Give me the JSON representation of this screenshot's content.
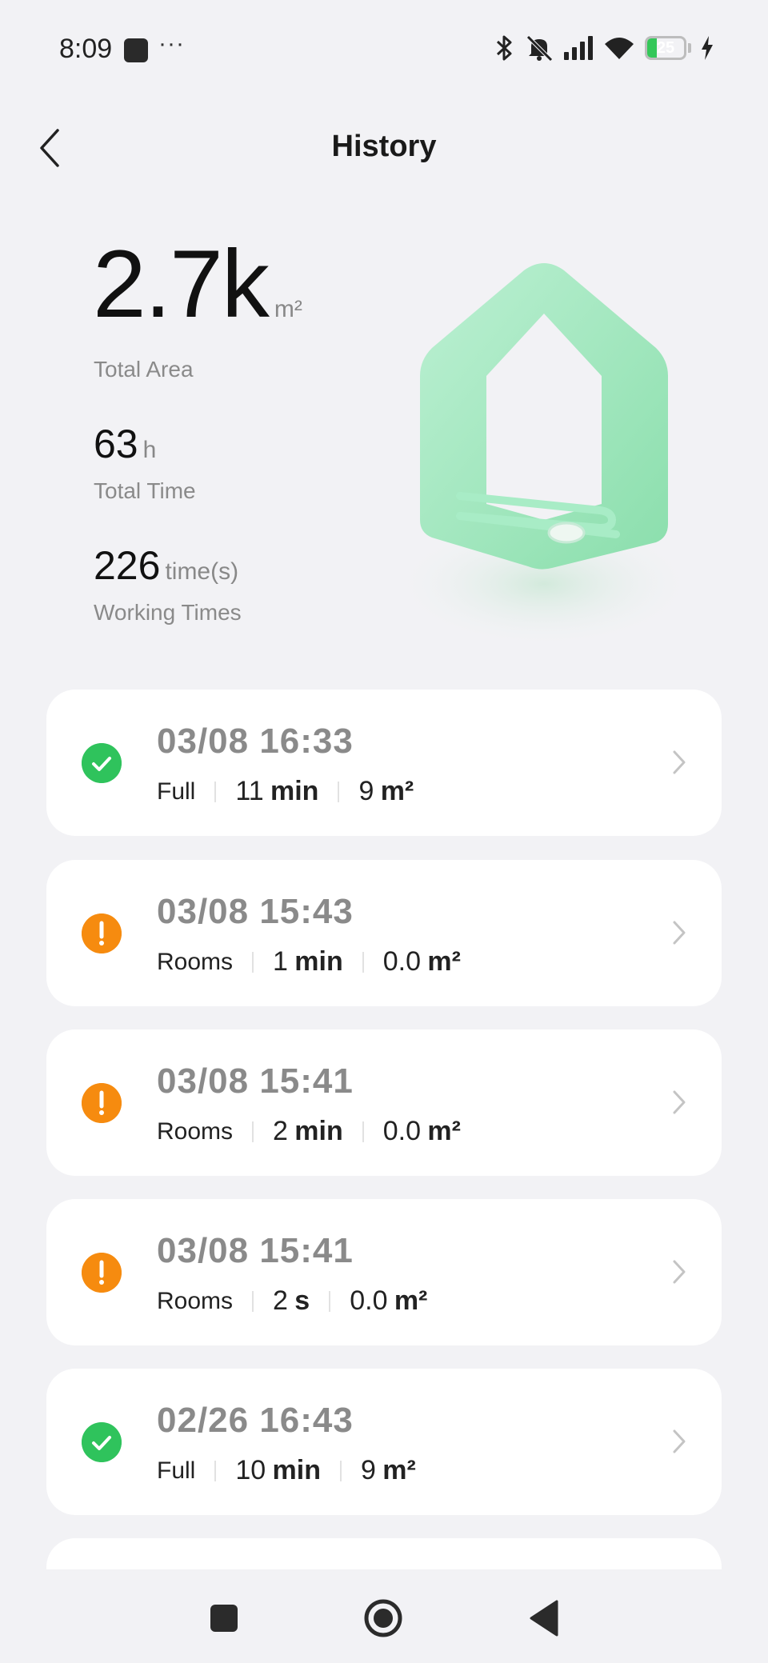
{
  "status_bar": {
    "time": "8:09",
    "more": "···",
    "battery_level": "25",
    "battery_fraction": 0.25,
    "battery_color": "#34c759"
  },
  "header": {
    "title": "History",
    "back_icon": "chevron-left-icon"
  },
  "stats": {
    "total_area_value": "2.7k",
    "total_area_unit": "m²",
    "total_area_label": "Total Area",
    "total_time_value": "63",
    "total_time_unit": "h",
    "total_time_label": "Total Time",
    "working_times_value": "226",
    "working_times_unit": "time(s)",
    "working_times_label": "Working Times"
  },
  "colors": {
    "ok": "#2fc35c",
    "warn": "#f68b0f",
    "house": "#8fe3b2"
  },
  "records": [
    {
      "datetime": "03/08  16:33",
      "mode": "Full",
      "duration_num": "11",
      "duration_unit": "min",
      "area_num": "9",
      "area_unit": "m²",
      "status": "ok",
      "status_icon": "check-icon"
    },
    {
      "datetime": "03/08  15:43",
      "mode": "Rooms",
      "duration_num": "1",
      "duration_unit": "min",
      "area_num": "0.0",
      "area_unit": "m²",
      "status": "warn",
      "status_icon": "exclamation-icon"
    },
    {
      "datetime": "03/08  15:41",
      "mode": "Rooms",
      "duration_num": "2",
      "duration_unit": "min",
      "area_num": "0.0",
      "area_unit": "m²",
      "status": "warn",
      "status_icon": "exclamation-icon"
    },
    {
      "datetime": "03/08  15:41",
      "mode": "Rooms",
      "duration_num": "2",
      "duration_unit": "s",
      "area_num": "0.0",
      "area_unit": "m²",
      "status": "warn",
      "status_icon": "exclamation-icon"
    },
    {
      "datetime": "02/26  16:43",
      "mode": "Full",
      "duration_num": "10",
      "duration_unit": "min",
      "area_num": "9",
      "area_unit": "m²",
      "status": "ok",
      "status_icon": "check-icon"
    }
  ]
}
